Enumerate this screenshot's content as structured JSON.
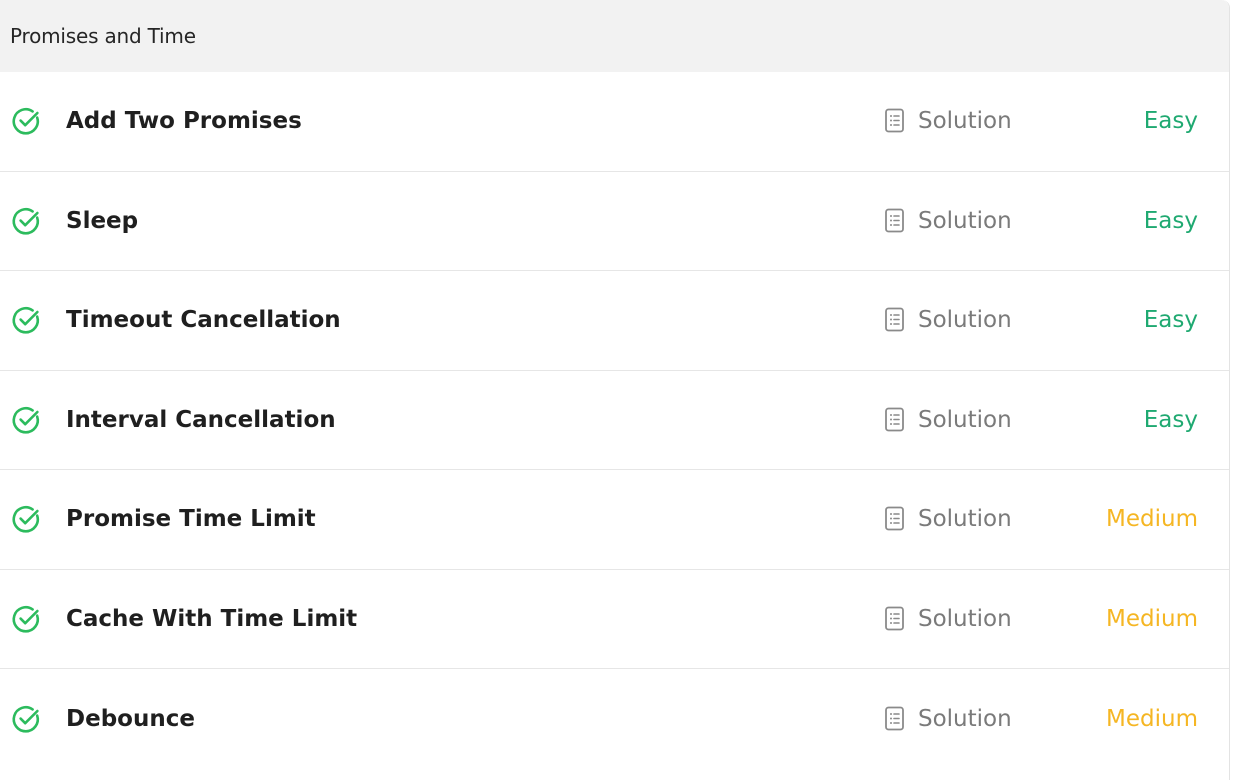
{
  "section": {
    "title": "Promises and Time"
  },
  "colors": {
    "check": "#2cbb5d",
    "easy": "#1fa971",
    "medium": "#f5b623",
    "solution_text": "#7a7a7a",
    "header_bg": "#f2f2f2"
  },
  "icons": {
    "status": "check-circle-icon",
    "solution": "document-icon"
  },
  "problems": [
    {
      "title": "Add Two Promises",
      "solution_label": "Solution",
      "difficulty": "Easy",
      "status": "solved"
    },
    {
      "title": "Sleep",
      "solution_label": "Solution",
      "difficulty": "Easy",
      "status": "solved"
    },
    {
      "title": "Timeout Cancellation",
      "solution_label": "Solution",
      "difficulty": "Easy",
      "status": "solved"
    },
    {
      "title": "Interval Cancellation",
      "solution_label": "Solution",
      "difficulty": "Easy",
      "status": "solved"
    },
    {
      "title": "Promise Time Limit",
      "solution_label": "Solution",
      "difficulty": "Medium",
      "status": "solved"
    },
    {
      "title": "Cache With Time Limit",
      "solution_label": "Solution",
      "difficulty": "Medium",
      "status": "solved"
    },
    {
      "title": "Debounce",
      "solution_label": "Solution",
      "difficulty": "Medium",
      "status": "solved"
    }
  ]
}
